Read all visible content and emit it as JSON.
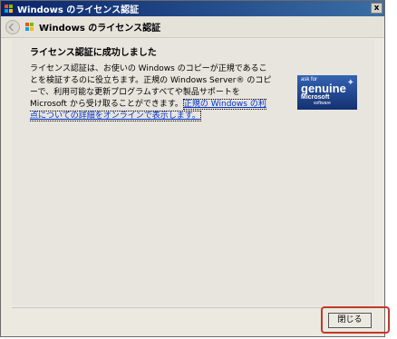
{
  "window": {
    "title": "Windows のライセンス認証",
    "close_glyph": "x"
  },
  "nav": {
    "title": "Windows のライセンス認証"
  },
  "main": {
    "heading": "ライセンス認証に成功しました",
    "body_text": "ライセンス認証は、お使いの Windows のコピーが正規であることを検証するのに役立ちます。正規の Windows Server® のコピーで、利用可能な更新プログラムすべてや製品サポートを Microsoft から受け取ることができます。",
    "link_text": "正規の Windows の利点についての詳細をオンラインで表示します。"
  },
  "badge": {
    "line1": "ask for",
    "line2": "genuine",
    "line3": "Microsoft",
    "line4": "software"
  },
  "footer": {
    "close_label": "閉じる"
  }
}
